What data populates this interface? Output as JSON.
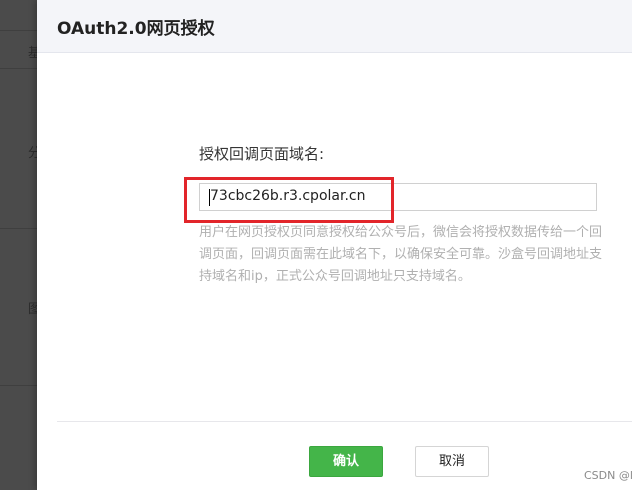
{
  "background": {
    "fragments": [
      "基",
      "分",
      "图"
    ]
  },
  "dialog": {
    "title": "OAuth2.0网页授权",
    "field_label": "授权回调页面域名:",
    "input_value": "73cbc26b.r3.cpolar.cn",
    "help_text": "用户在网页授权页同意授权给公众号后，微信会将授权数据传给一个回调页面，回调页面需在此域名下，以确保安全可靠。沙盒号回调地址支持域名和ip，正式公众号回调地址只支持域名。",
    "confirm_label": "确认",
    "cancel_label": "取消"
  },
  "watermark": "CSDN @luolai",
  "colors": {
    "primary_button": "#44b549",
    "highlight_border": "#e2252a",
    "overlay": "#5a5a5a"
  }
}
